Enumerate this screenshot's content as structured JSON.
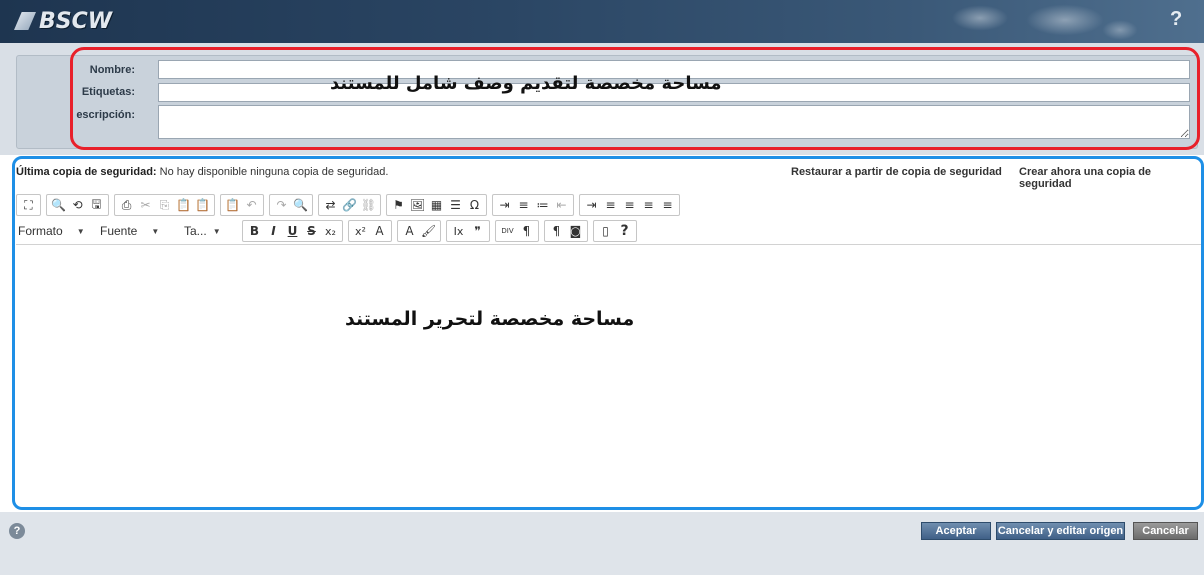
{
  "header": {
    "logo_text": "BSCW",
    "help_icon": "?"
  },
  "meta": {
    "name_label": "Nombre:",
    "name_value": "",
    "tags_label": "Etiquetas:",
    "tags_value": "",
    "desc_label": "escripción:",
    "desc_value": "",
    "annotation": "مساحة مخصصة لتقديم وصف شامل للمستند",
    "annotation_color": "#e8202a"
  },
  "backup": {
    "label": "Última copia de seguridad:",
    "status": "No hay disponible ninguna copia de seguridad.",
    "restore_link": "Restaurar a partir de copia de seguridad",
    "create_link": "Crear ahora una copia de seguridad"
  },
  "toolbar": {
    "row1": [
      [
        "maximize-icon",
        "⛶",
        false
      ],
      [
        "preview-icon",
        "🔍",
        false
      ],
      [
        "templates-icon",
        "⟲",
        false
      ],
      [
        "save-icon",
        "🖫",
        false
      ],
      [
        "print-icon",
        "⎙",
        false
      ],
      [
        "cut-icon",
        "✂",
        true
      ],
      [
        "copy-icon",
        "⎘",
        true
      ],
      [
        "paste-icon",
        "📋",
        false
      ],
      [
        "paste-text-icon",
        "📋",
        false
      ],
      [
        "paste-word-icon",
        "📋",
        false
      ],
      [
        "undo-icon",
        "↶",
        true
      ],
      [
        "redo-icon",
        "↷",
        true
      ],
      [
        "find-icon",
        "🔍",
        false
      ],
      [
        "replace-icon",
        "⇄",
        false
      ],
      [
        "link-icon",
        "🔗",
        false
      ],
      [
        "unlink-icon",
        "⛓",
        true
      ],
      [
        "anchor-icon",
        "⚑",
        false
      ],
      [
        "image-icon",
        "🖼",
        false
      ],
      [
        "table-icon",
        "▦",
        false
      ],
      [
        "hline-icon",
        "☰",
        false
      ],
      [
        "special-char-icon",
        "Ω",
        false
      ],
      [
        "page-break-icon",
        "⇥",
        false
      ],
      [
        "numbered-list-icon",
        "≡",
        false
      ],
      [
        "bulleted-list-icon",
        "≔",
        false
      ],
      [
        "outdent-icon",
        "⇤",
        true
      ],
      [
        "indent-icon",
        "⇥",
        false
      ],
      [
        "align-left-icon",
        "≡",
        false
      ],
      [
        "align-center-icon",
        "≡",
        false
      ],
      [
        "align-right-icon",
        "≡",
        false
      ],
      [
        "justify-icon",
        "≡",
        false
      ]
    ],
    "format_label": "Formato",
    "font_label": "Fuente",
    "size_label": "Ta...",
    "row2": [
      [
        "bold-icon",
        "B",
        false
      ],
      [
        "italic-icon",
        "I",
        false
      ],
      [
        "underline-icon",
        "U",
        false
      ],
      [
        "strike-icon",
        "S",
        false
      ],
      [
        "subscript-icon",
        "x₂",
        false
      ],
      [
        "superscript-icon",
        "x²",
        false
      ],
      [
        "text-color-icon",
        "A",
        false
      ],
      [
        "bg-color-icon",
        "A",
        false
      ],
      [
        "copy-format-icon",
        "🖌",
        false
      ],
      [
        "remove-format-icon",
        "Ix",
        false
      ],
      [
        "blockquote-icon",
        "❞",
        false
      ],
      [
        "div-icon",
        "DIV",
        false
      ],
      [
        "ltr-icon",
        "¶",
        false
      ],
      [
        "rtl-icon",
        "¶",
        false
      ],
      [
        "source-icon",
        "◙",
        false
      ],
      [
        "show-blocks-icon",
        "▯",
        false
      ],
      [
        "help-icon",
        "?",
        false
      ]
    ],
    "separators_row1": [
      1,
      4,
      9,
      11,
      13,
      16,
      21,
      25
    ],
    "separators_row2": [
      5,
      7,
      9,
      11,
      13,
      15
    ]
  },
  "editor": {
    "annotation": "مساحة مخصصة لتحرير المستند",
    "annotation_color": "#1e8fe6"
  },
  "footer": {
    "help_icon": "?",
    "accept_label": "Aceptar",
    "cancel_edit_label": "Cancelar y editar origen",
    "cancel_label": "Cancelar"
  }
}
